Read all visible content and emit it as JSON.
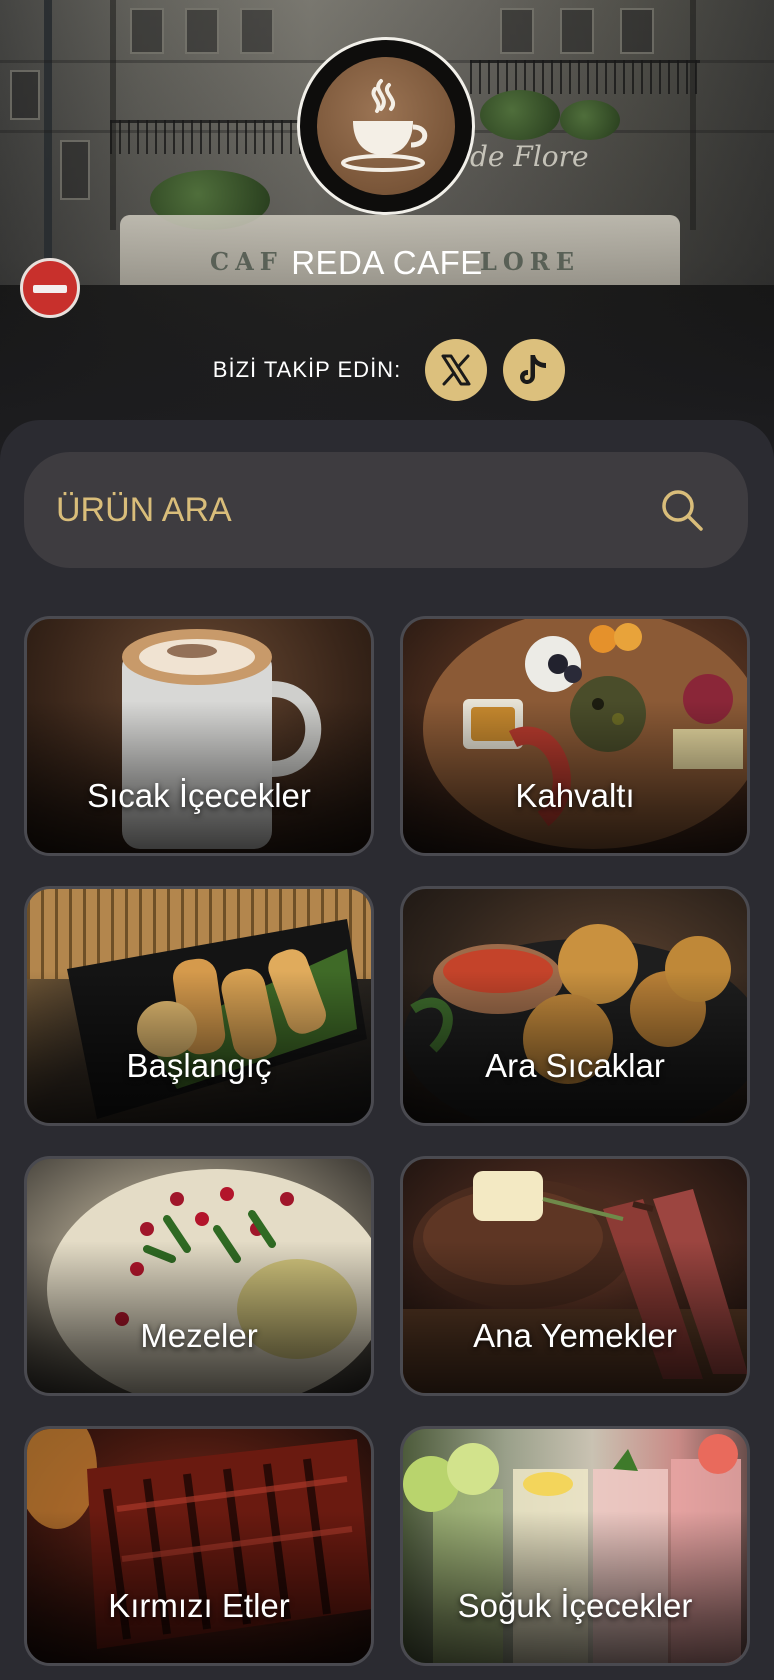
{
  "header": {
    "brand": "REDA CAFE",
    "follow_label": "BİZİ TAKİP EDİN:",
    "social": [
      {
        "icon": "x-icon"
      },
      {
        "icon": "tiktok-icon"
      }
    ],
    "accent_color": "#dcc07d"
  },
  "search": {
    "placeholder": "ÜRÜN ARA",
    "value": ""
  },
  "categories": [
    {
      "label": "Sıcak İçecekler"
    },
    {
      "label": "Kahvaltı"
    },
    {
      "label": "Başlangıç"
    },
    {
      "label": "Ara Sıcaklar"
    },
    {
      "label": "Mezeler"
    },
    {
      "label": "Ana Yemekler"
    },
    {
      "label": "Kırmızı Etler"
    },
    {
      "label": "Soğuk İçecekler"
    }
  ]
}
